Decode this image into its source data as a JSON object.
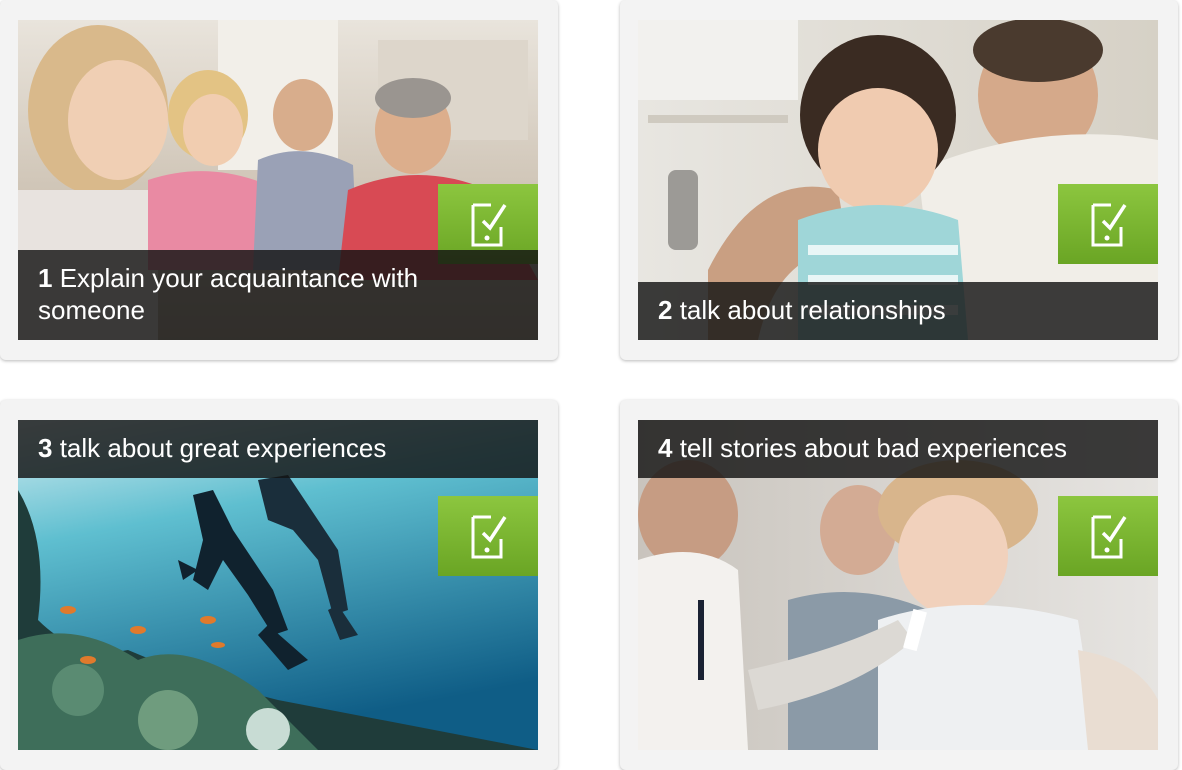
{
  "cards": [
    {
      "number": "1",
      "title": "Explain your acquaintance with someone",
      "icon": "mobile-checklist-icon"
    },
    {
      "number": "2",
      "title": "talk about relationships",
      "icon": "mobile-checklist-icon"
    },
    {
      "number": "3",
      "title": "talk about great experiences",
      "icon": "mobile-checklist-icon"
    },
    {
      "number": "4",
      "title": "tell stories about bad experiences",
      "icon": "mobile-checklist-icon"
    }
  ],
  "colors": {
    "badge": "#7ab532",
    "caption_bg": "#141414",
    "card_bg": "#f3f3f3"
  }
}
